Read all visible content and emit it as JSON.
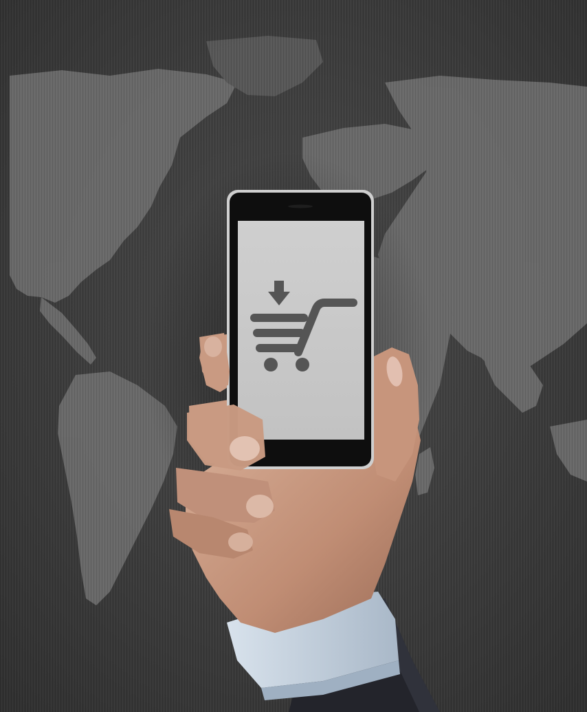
{
  "scene": {
    "background_color": "#3e3e3e",
    "map_color": "#6f6f6f",
    "phone_body_color": "#0e0e0e",
    "phone_rim_color": "#d0d0d0",
    "screen_color": "#c8c8c8",
    "icon_color": "#555555",
    "skin_color": "#c89e86",
    "shirt_color": "#c2d0de",
    "suit_color": "#2a2b33"
  },
  "icons": {
    "screen_icon": "add-to-cart-icon"
  }
}
